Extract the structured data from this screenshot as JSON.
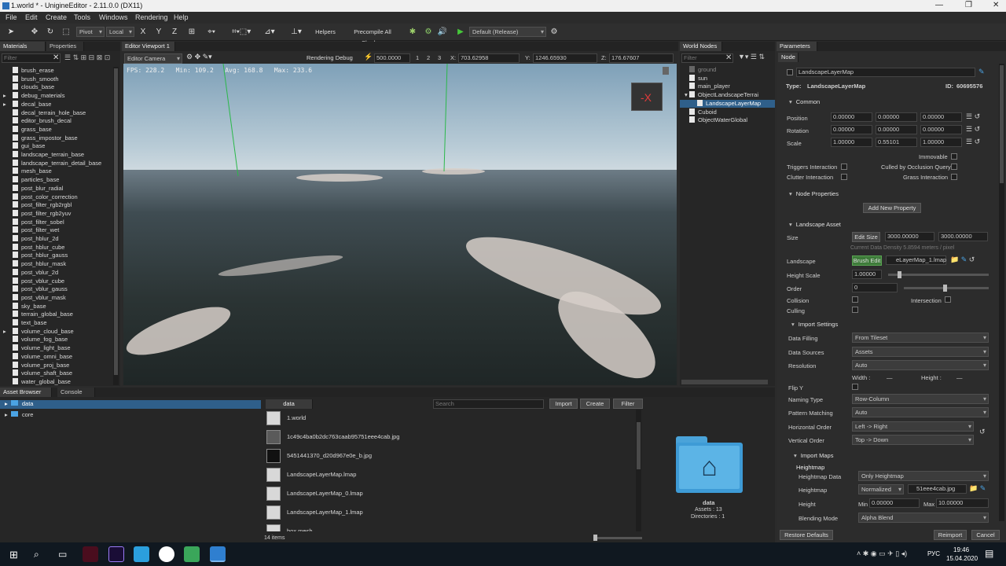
{
  "window": {
    "title": "1.world * - UnigineEditor - 2.11.0.0 (DX11)"
  },
  "menu": [
    "File",
    "Edit",
    "Create",
    "Tools",
    "Windows",
    "Rendering",
    "Help"
  ],
  "toolbar": {
    "pivot": "Pivot",
    "local": "Local",
    "x": "X",
    "y": "Y",
    "z": "Z",
    "helpers": "Helpers",
    "precompile": "Precompile All Shaders",
    "config": "Default (Release)"
  },
  "materials_panel": {
    "tabs": [
      "Materials",
      "Properties"
    ],
    "filter_placeholder": "Filter",
    "items": [
      "brush_erase",
      "brush_smooth",
      "clouds_base",
      "debug_materials",
      "decal_base",
      "decal_terrain_hole_base",
      "editor_brush_decal",
      "grass_base",
      "grass_impostor_base",
      "gui_base",
      "landscape_terrain_base",
      "landscape_terrain_detail_base",
      "mesh_base",
      "particles_base",
      "post_blur_radial",
      "post_color_correction",
      "post_filter_rgb2rgbl",
      "post_filter_rgb2yuv",
      "post_filter_sobel",
      "post_filter_wet",
      "post_hblur_2d",
      "post_hblur_cube",
      "post_hblur_gauss",
      "post_hblur_mask",
      "post_vblur_2d",
      "post_vblur_cube",
      "post_vblur_gauss",
      "post_vblur_mask",
      "sky_base",
      "terrain_global_base",
      "text_base",
      "volume_cloud_base",
      "volume_fog_base",
      "volume_light_base",
      "volume_omni_base",
      "volume_proj_base",
      "volume_shaft_base",
      "water_global_base"
    ]
  },
  "viewport": {
    "tab": "Editor Viewport 1",
    "camera": "Editor Camera",
    "rendering_debug": "Rendering Debug",
    "speed": "500.0000",
    "speed_presets": [
      "1",
      "2",
      "3"
    ],
    "x_label": "X:",
    "x_value": "703.62958",
    "y_label": "Y:",
    "y_value": "1246.65930",
    "z_label": "Z:",
    "z_value": "176.67607",
    "fps": "FPS: 228.2   Min: 109.2   Avg: 168.8   Max: 233.6",
    "gizmo_label": "-X"
  },
  "world_nodes": {
    "tab": "World Nodes",
    "filter_placeholder": "Filter",
    "items": [
      "ground",
      "sun",
      "main_player",
      "ObjectLandscapeTerrai",
      "LandscapeLayerMap",
      "Cuboid",
      "ObjectWaterGlobal"
    ]
  },
  "parameters": {
    "tab": "Parameters",
    "subtab": "Node",
    "node_name": "LandscapeLayerMap",
    "type_label": "Type:",
    "type_value": "LandscapeLayerMap",
    "id_label": "ID:",
    "id_value": "60695576",
    "common": "Common",
    "position_label": "Position",
    "position": [
      "0.00000",
      "0.00000",
      "0.00000"
    ],
    "rotation_label": "Rotation",
    "rotation": [
      "0.00000",
      "0.00000",
      "0.00000"
    ],
    "scale_label": "Scale",
    "scale": [
      "1.00000",
      "0.55101",
      "1.00000"
    ],
    "immovable": "Immovable",
    "triggers": "Triggers Interaction",
    "culled": "Culled by Occlusion Query",
    "clutter": "Clutter Interaction",
    "grass": "Grass Interaction",
    "node_props": "Node Properties",
    "add_prop": "Add New Property",
    "landscape_asset": "Landscape Asset",
    "size_label": "Size",
    "edit_size": "Edit Size",
    "size": [
      "3000.00000",
      "3000.00000"
    ],
    "density": "Current Data Density 5.8594 meters / pixel",
    "landscape_label": "Landscape",
    "brush_edit": "Brush Edit",
    "landscape_file": "eLayerMap_1.lmap",
    "height_scale_label": "Height Scale",
    "height_scale": "1.00000",
    "order_label": "Order",
    "order": "0",
    "collision": "Collision",
    "intersection": "Intersection",
    "culling": "Culling",
    "import_settings": "Import Settings",
    "data_filling_label": "Data Filling",
    "data_filling": "From Tileset",
    "data_sources_label": "Data Sources",
    "data_sources": "Assets",
    "resolution_label": "Resolution",
    "resolution": "Auto",
    "width_label": "Width :",
    "width_val": "—",
    "height_label2": "Height :",
    "height_val2": "—",
    "flip_y": "Flip Y",
    "naming_label": "Naming Type",
    "naming": "Row-Column",
    "pattern_label": "Pattern Matching",
    "pattern": "Auto",
    "horiz_label": "Horizontal Order",
    "horiz": "Left -> Right",
    "vert_label": "Vertical Order",
    "vert": "Top -> Down",
    "import_maps": "Import Maps",
    "heightmap_hdr": "Heightmap",
    "hm_data_label": "Heightmap Data",
    "hm_data": "Only Heightmap",
    "hm_label": "Heightmap",
    "hm_mode": "Normalized",
    "hm_file": "51eee4cab.jpg",
    "height_label": "Height",
    "min_label": "Min",
    "min": "0.00000",
    "max_label": "Max",
    "max": "10.00000",
    "blend_label": "Blending Mode",
    "blend": "Alpha Blend",
    "restore": "Restore Defaults",
    "reimport": "Reimport",
    "cancel": "Cancel"
  },
  "asset_browser": {
    "tabs": [
      "Asset Browser",
      "Console"
    ],
    "tree": [
      "data",
      "core"
    ],
    "path": "data",
    "search_placeholder": "Search",
    "import": "Import",
    "create": "Create",
    "filter": "Filter",
    "files": [
      "1.world",
      "1c49c4ba0b2dc763caab95751eee4cab.jpg",
      "5451441370_d20d967e0e_b.jpg",
      "LandscapeLayerMap.lmap",
      "LandscapeLayerMap_0.lmap",
      "LandscapeLayerMap_1.lmap",
      "box.mesh"
    ],
    "count": "14 items",
    "preview_name": "data",
    "preview_assets": "Assets : 13",
    "preview_dirs": "Directories : 1"
  },
  "taskbar": {
    "lang": "РУС",
    "time": "19:46",
    "date": "15.04.2020"
  }
}
